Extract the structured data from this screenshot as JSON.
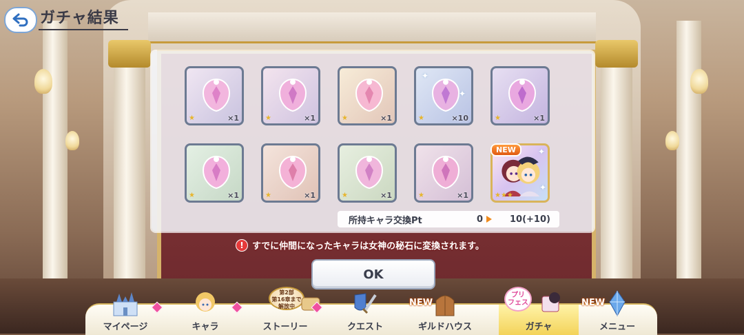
{
  "header": {
    "title": "ガチャ結果",
    "back_icon": "back-arrow-icon"
  },
  "results": {
    "items": [
      {
        "kind": "memory-piece",
        "quantity": "×1",
        "stars": "★"
      },
      {
        "kind": "memory-piece",
        "quantity": "×1",
        "stars": "★"
      },
      {
        "kind": "memory-piece",
        "quantity": "×1",
        "stars": "★"
      },
      {
        "kind": "memory-piece",
        "quantity": "×10",
        "stars": "★"
      },
      {
        "kind": "memory-piece",
        "quantity": "×1",
        "stars": "★"
      },
      {
        "kind": "memory-piece",
        "quantity": "×1",
        "stars": "★"
      },
      {
        "kind": "memory-piece",
        "quantity": "×1",
        "stars": "★"
      },
      {
        "kind": "memory-piece",
        "quantity": "×1",
        "stars": "★"
      },
      {
        "kind": "memory-piece",
        "quantity": "×1",
        "stars": "★"
      },
      {
        "kind": "character",
        "badge": "NEW",
        "stars": "★★★"
      }
    ]
  },
  "exchange_pt": {
    "label": "所持キャラ交換Pt",
    "from": "0",
    "to": "10(+10)"
  },
  "notice": {
    "icon": "!",
    "text": "すでに仲間になったキャラは女神の秘石に変換されます。"
  },
  "ok_button": {
    "label": "OK"
  },
  "nav": {
    "items": [
      {
        "label": "マイページ",
        "icon": "castle-icon"
      },
      {
        "label": "キャラ",
        "icon": "character-icon"
      },
      {
        "label": "ストーリー",
        "icon": "scroll-icon"
      },
      {
        "label": "クエスト",
        "icon": "sword-shield-icon"
      },
      {
        "label": "ギルドハウス",
        "icon": "door-icon",
        "badge": "NEW"
      },
      {
        "label": "ガチャ",
        "icon": "gacha-icon"
      },
      {
        "label": "メニュー",
        "icon": "crystal-icon",
        "badge": "NEW"
      }
    ],
    "story_badge": [
      "第2部",
      "第16章まで",
      "解放中"
    ],
    "prifes_badge": [
      "プリ",
      "フェス"
    ]
  }
}
